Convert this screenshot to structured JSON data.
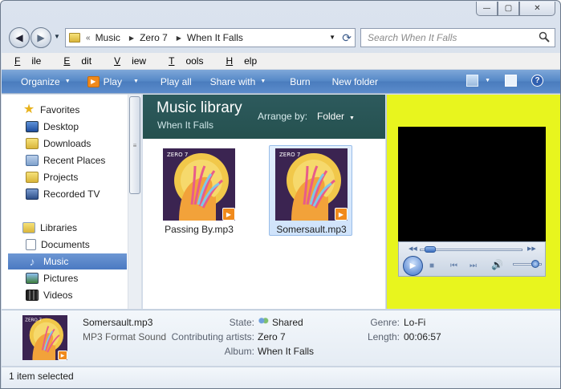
{
  "window": {
    "caption": {
      "minimize": "—",
      "maximize": "▢",
      "close": "✕"
    }
  },
  "nav": {
    "back_icon": "back-arrow-icon",
    "forward_icon": "forward-arrow-icon",
    "address": {
      "overflow": "«",
      "crumbs": [
        "Music",
        "Zero 7",
        "When It Falls"
      ]
    },
    "search_placeholder": "Search When It Falls"
  },
  "menubar": {
    "items": [
      {
        "key": "F",
        "rest": "ile"
      },
      {
        "key": "E",
        "rest": "dit"
      },
      {
        "key": "V",
        "rest": "iew"
      },
      {
        "key": "T",
        "rest": "ools"
      },
      {
        "key": "H",
        "rest": "elp"
      }
    ]
  },
  "commandbar": {
    "organize": "Organize",
    "play": "Play",
    "play_all": "Play all",
    "share_with": "Share with",
    "burn": "Burn",
    "new_folder": "New folder",
    "help": "?"
  },
  "navpane": {
    "favorites": "Favorites",
    "favorites_items": [
      "Desktop",
      "Downloads",
      "Recent Places",
      "Projects",
      "Recorded TV"
    ],
    "libraries": "Libraries",
    "libraries_items": [
      "Documents",
      "Music",
      "Pictures",
      "Videos"
    ],
    "selected": "Music"
  },
  "content": {
    "title": "Music library",
    "subtitle": "When It Falls",
    "arrange_label": "Arrange by:",
    "arrange_value": "Folder",
    "files": [
      {
        "name": "Passing By.mp3",
        "selected": false
      },
      {
        "name": "Somersault.mp3",
        "selected": true
      }
    ],
    "album_art_text": "ZERO 7"
  },
  "preview": {
    "seek_fraction": 0.05,
    "volume_fraction": 0.75
  },
  "details": {
    "name": "Somersault.mp3",
    "type": "MP3 Format Sound",
    "state_label": "State:",
    "state_value": "Shared",
    "artists_label": "Contributing artists:",
    "artists_value": "Zero 7",
    "album_label": "Album:",
    "album_value": "When It Falls",
    "genre_label": "Genre:",
    "genre_value": "Lo-Fi",
    "length_label": "Length:",
    "length_value": "00:06:57"
  },
  "status": {
    "text": "1 item selected"
  },
  "colors": {
    "preview_bg": "#e8f51e",
    "library_header": "#2d5a5d",
    "commandbar": "#4a7cbd",
    "selection": "#4b79c2"
  }
}
